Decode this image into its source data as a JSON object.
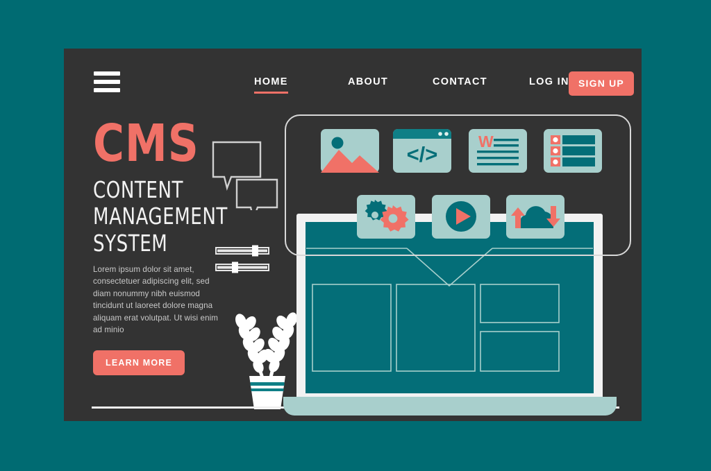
{
  "theme": {
    "page_background": "#006b72",
    "card_background": "#333333",
    "accent_coral": "#f07167",
    "teal_dark": "#046e78",
    "teal_light": "#a8cfcc",
    "text_light": "#ffffff",
    "text_muted": "#c9c9c9"
  },
  "nav": {
    "menu_icon": "hamburger-menu-icon",
    "items": [
      {
        "label": "HOME",
        "active": true
      },
      {
        "label": "ABOUT",
        "active": false
      },
      {
        "label": "CONTACT",
        "active": false
      },
      {
        "label": "LOG IN",
        "active": false
      }
    ],
    "signup_label": "SIGN UP"
  },
  "hero": {
    "brand": "CMS",
    "headline": "CONTENT\nMANAGEMENT\nSYSTEM",
    "paragraph": "Lorem ipsum dolor sit amet, consectetuer adipiscing elit, sed diam nonummy nibh euismod tincidunt ut laoreet dolore magna aliquam erat volutpat. Ut wisi enim ad minio",
    "cta_label": "LEARN MORE"
  },
  "decorations": {
    "speech_bubbles": "speech-bubbles-icon",
    "sliders": [
      {
        "name": "slider-top",
        "handle_percent": 76
      },
      {
        "name": "slider-bottom",
        "handle_percent": 36
      }
    ],
    "plant": "potted-plant-illustration",
    "ground_line": "ground-line"
  },
  "feature_panel": {
    "row_one": [
      {
        "name": "image-icon",
        "label": "Image"
      },
      {
        "name": "code-window-icon",
        "label": "</>"
      },
      {
        "name": "word-document-icon",
        "label": "W"
      },
      {
        "name": "list-database-icon",
        "label": "List"
      }
    ],
    "row_two": [
      {
        "name": "gears-icon",
        "label": "Settings"
      },
      {
        "name": "play-button-icon",
        "label": "Play"
      },
      {
        "name": "cloud-sync-icon",
        "label": "Cloud"
      }
    ]
  },
  "laptop": {
    "name": "laptop-mockup",
    "screen_blocks": [
      "block-left",
      "block-center",
      "block-right-top",
      "block-right-bottom"
    ]
  }
}
